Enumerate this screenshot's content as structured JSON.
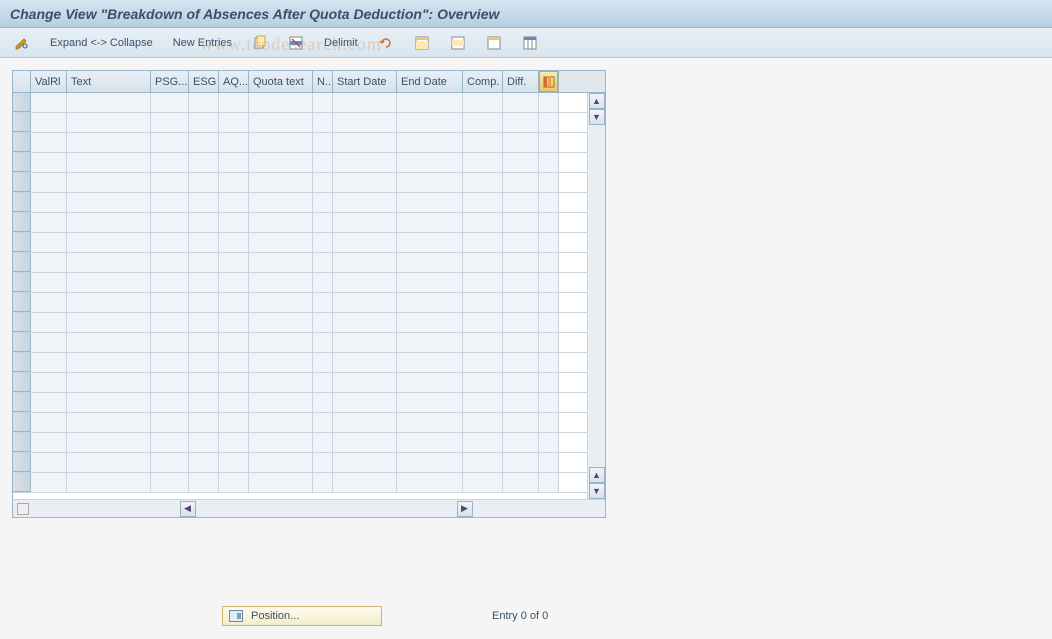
{
  "title": "Change View \"Breakdown of Absences After Quota Deduction\": Overview",
  "toolbar": {
    "expand_collapse": "Expand <-> Collapse",
    "new_entries": "New Entries",
    "delimit": "Delimit"
  },
  "columns": {
    "valrl": "ValRl",
    "text": "Text",
    "psg": "PSG...",
    "esg": "ESG",
    "aq": "AQ...",
    "quota_text": "Quota text",
    "n": "N..",
    "start_date": "Start Date",
    "end_date": "End Date",
    "comp": "Comp.",
    "diff": "Diff."
  },
  "footer": {
    "position_label": "Position...",
    "entry_text": "Entry 0 of 0"
  },
  "watermark": "www.tcodesearch.com",
  "row_count": 20
}
